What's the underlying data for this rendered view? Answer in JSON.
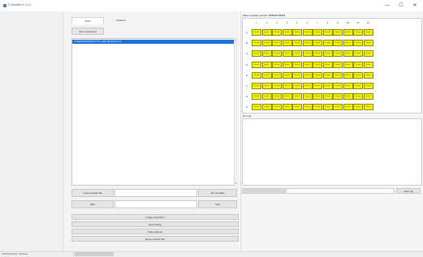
{
  "window": {
    "title": "E-Smart94 v1.1.2.3",
    "controls": {
      "minimize": "—",
      "maximize": "☐",
      "close": "✕"
    }
  },
  "tabs": [
    {
      "label": "Wells"
    },
    {
      "label": "Statistics"
    }
  ],
  "main": {
    "top_button": "Run experiment",
    "selected_item": "C:\\Data\\Plate\\2016-07-04 \\ plate 96 well R1.csv",
    "row1": {
      "left_button": "Load template file",
      "right_button": "Set template"
    },
    "row2": {
      "left_button": "Start",
      "right_button": "Stop"
    },
    "actions": [
      "Image acquisition",
      "Spot finding",
      "Data analysis",
      "Export results files"
    ]
  },
  "plate": {
    "label": "Plate template preview:",
    "id": "2016-07-04 R1",
    "columns": [
      "1",
      "2",
      "3",
      "4",
      "5",
      "6",
      "7",
      "8",
      "9",
      "10",
      "11",
      "12"
    ],
    "rows": [
      "A",
      "B",
      "C",
      "D",
      "E",
      "F",
      "G",
      "H"
    ],
    "well_text": "Sample",
    "well_color": "#f7f000"
  },
  "info": {
    "label": "Run log"
  },
  "progress": {
    "value": 0.29,
    "button": "Clear log"
  },
  "status": {
    "text": "Disconnected: Camera",
    "fill": 0.5
  },
  "colors": {
    "accent": "#1e6fd9",
    "well": "#f7f000"
  }
}
